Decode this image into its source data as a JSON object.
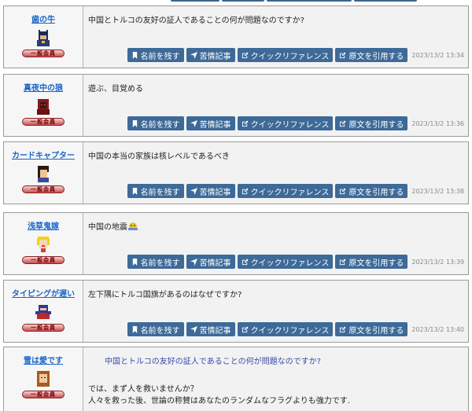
{
  "buttons": {
    "name": "名前を残す",
    "complaint": "苦情記事",
    "quick": "クイックリファレンス",
    "quote": "原文を引用する"
  },
  "badge_text": "一般会員",
  "posts": [
    {
      "user": "歯の牛",
      "message": "中国とトルコの友好の証人であることの何が問題なのですか?",
      "time": "2023/13/2 13:34",
      "avatar_icon": "masked-hero-avatar-icon"
    },
    {
      "user": "真夜中の狼",
      "message": "遊ぶ、目覚める",
      "time": "2023/13/2 13:36",
      "avatar_icon": "red-haired-avatar-icon"
    },
    {
      "user": "カードキャプター",
      "message": "中国の本当の家族は核レベルであるべき",
      "time": "2023/13/2 13:38",
      "avatar_icon": "dark-haired-avatar-icon"
    },
    {
      "user": "浅草鬼嫁",
      "message": "中国の地震",
      "time": "2023/13/2 13:39",
      "avatar_icon": "blonde-avatar-icon"
    },
    {
      "user": "タイピングが遅い",
      "message": "左下隅にトルコ国旗があるのはなぜですか?",
      "time": "2023/13/2 13:40",
      "avatar_icon": "ninja-avatar-icon"
    },
    {
      "user": "雪は愛です",
      "quote": "中国とトルコの友好の証人であることの何が問題なのですか?",
      "line2": "では、まず人を救いませんか？",
      "line3": "人々を救った後、世論の称賛はあなたのランダムなフラグよりも強力です.",
      "avatar_icon": "brown-haired-avatar-icon"
    }
  ],
  "colors": {
    "button": "#3d6a98",
    "username": "#1a64c8",
    "quote": "#3949a8",
    "border": "#9a9a9a"
  }
}
